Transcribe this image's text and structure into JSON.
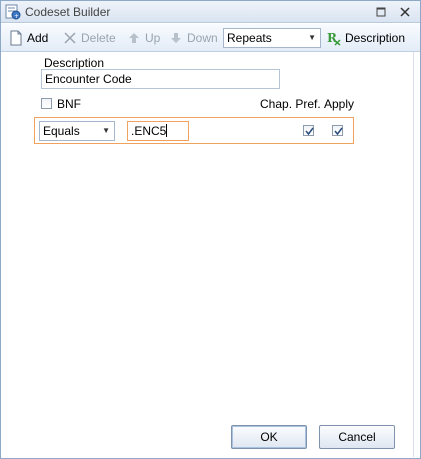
{
  "window": {
    "title": "Codeset Builder",
    "minimize_icon": "minimize-icon",
    "close_icon": "close-icon"
  },
  "toolbar": {
    "add_label": "Add",
    "delete_label": "Delete",
    "up_label": "Up",
    "down_label": "Down",
    "mode_value": "Repeats",
    "description_label": "Description"
  },
  "form": {
    "description_label": "Description",
    "description_value": "Encounter Code",
    "bnf_label": "BNF",
    "bnf_checked": false,
    "chap_pref_label": "Chap. Pref.",
    "apply_label": "Apply"
  },
  "condition": {
    "operator_value": "Equals",
    "code_value": ".ENC5",
    "chap_pref_checked": true,
    "apply_checked": true
  },
  "buttons": {
    "ok_label": "OK",
    "cancel_label": "Cancel"
  },
  "colors": {
    "accent_border": "#f0a35e",
    "titlebar": "#dae4f1"
  }
}
